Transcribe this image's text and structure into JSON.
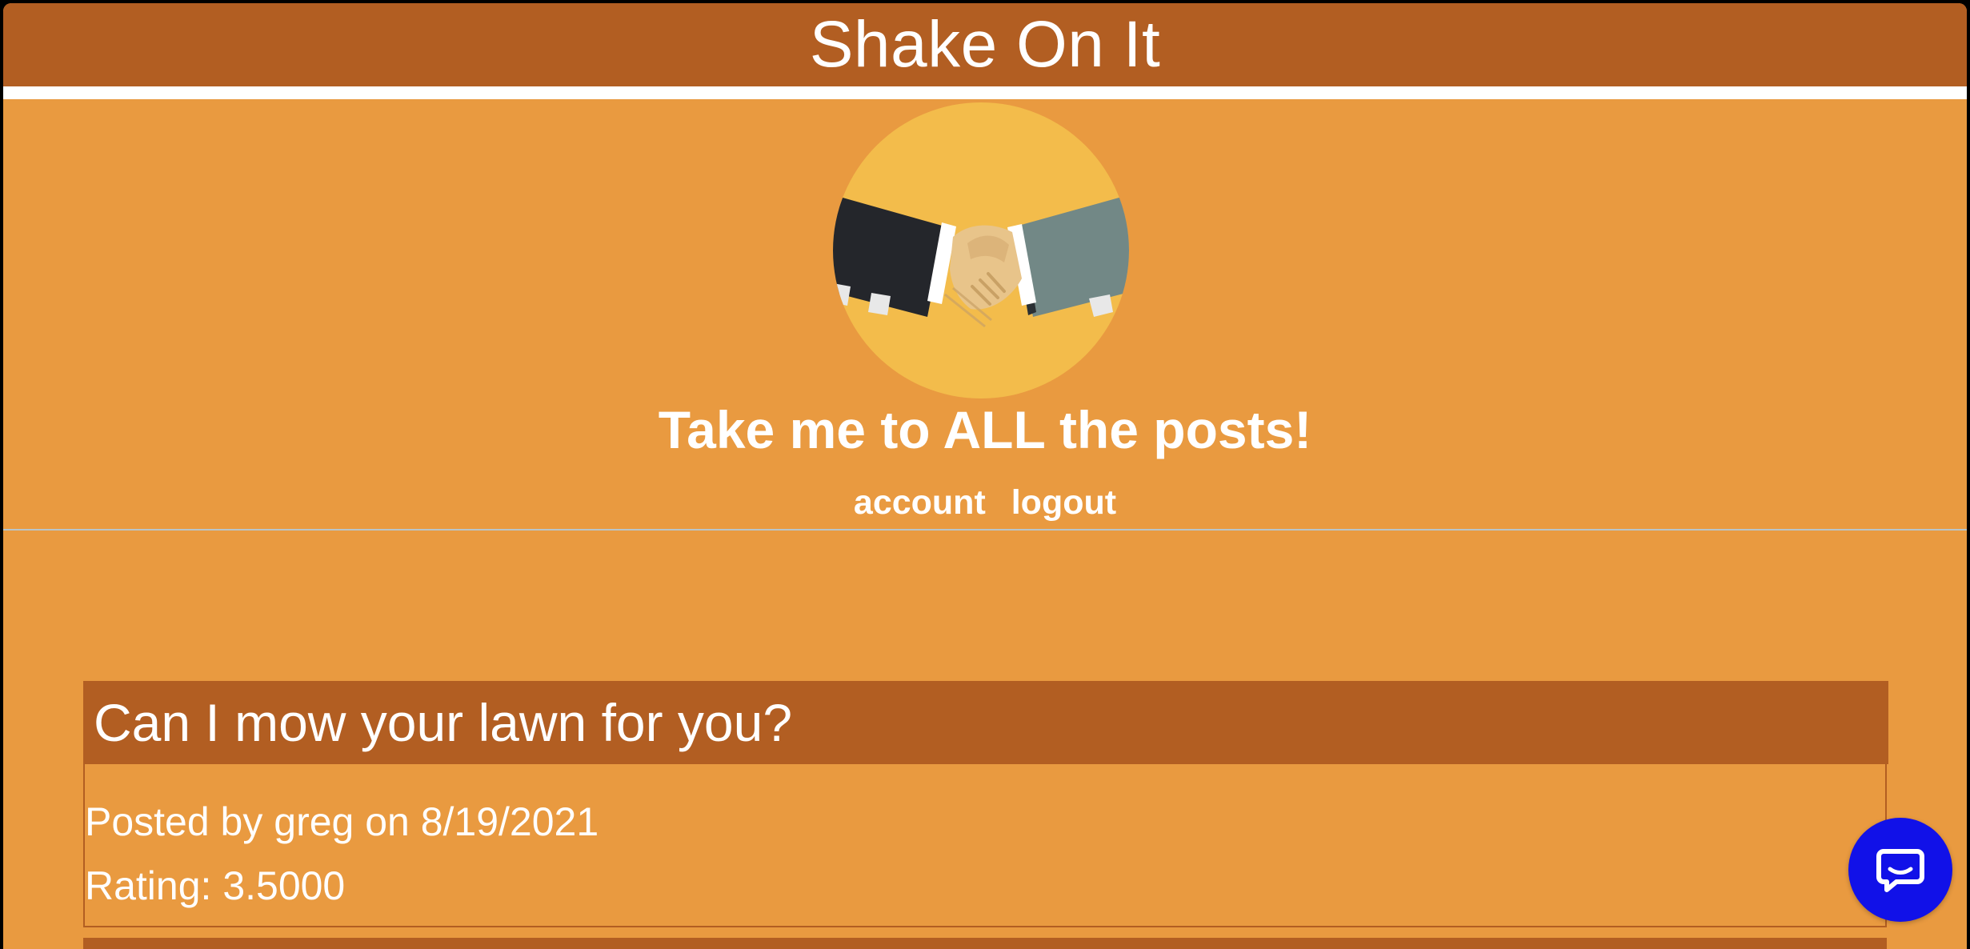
{
  "header": {
    "title": "Shake On It"
  },
  "logo": {
    "icon": "handshake-icon"
  },
  "hero": {
    "all_posts_link": "Take me to ALL the posts!"
  },
  "nav": {
    "account": "account",
    "logout": "logout"
  },
  "posts": [
    {
      "title": "Can I mow your lawn for you?",
      "meta": "Posted by greg on 8/19/2021",
      "rating": "Rating: 3.5000"
    }
  ],
  "chat": {
    "icon": "chat-icon"
  },
  "colors": {
    "page_bg": "#e99a40",
    "header_bg": "#b25e22",
    "logo_bg": "#f3bc4b",
    "chat_bg": "#1111e8",
    "text": "#ffffff"
  }
}
